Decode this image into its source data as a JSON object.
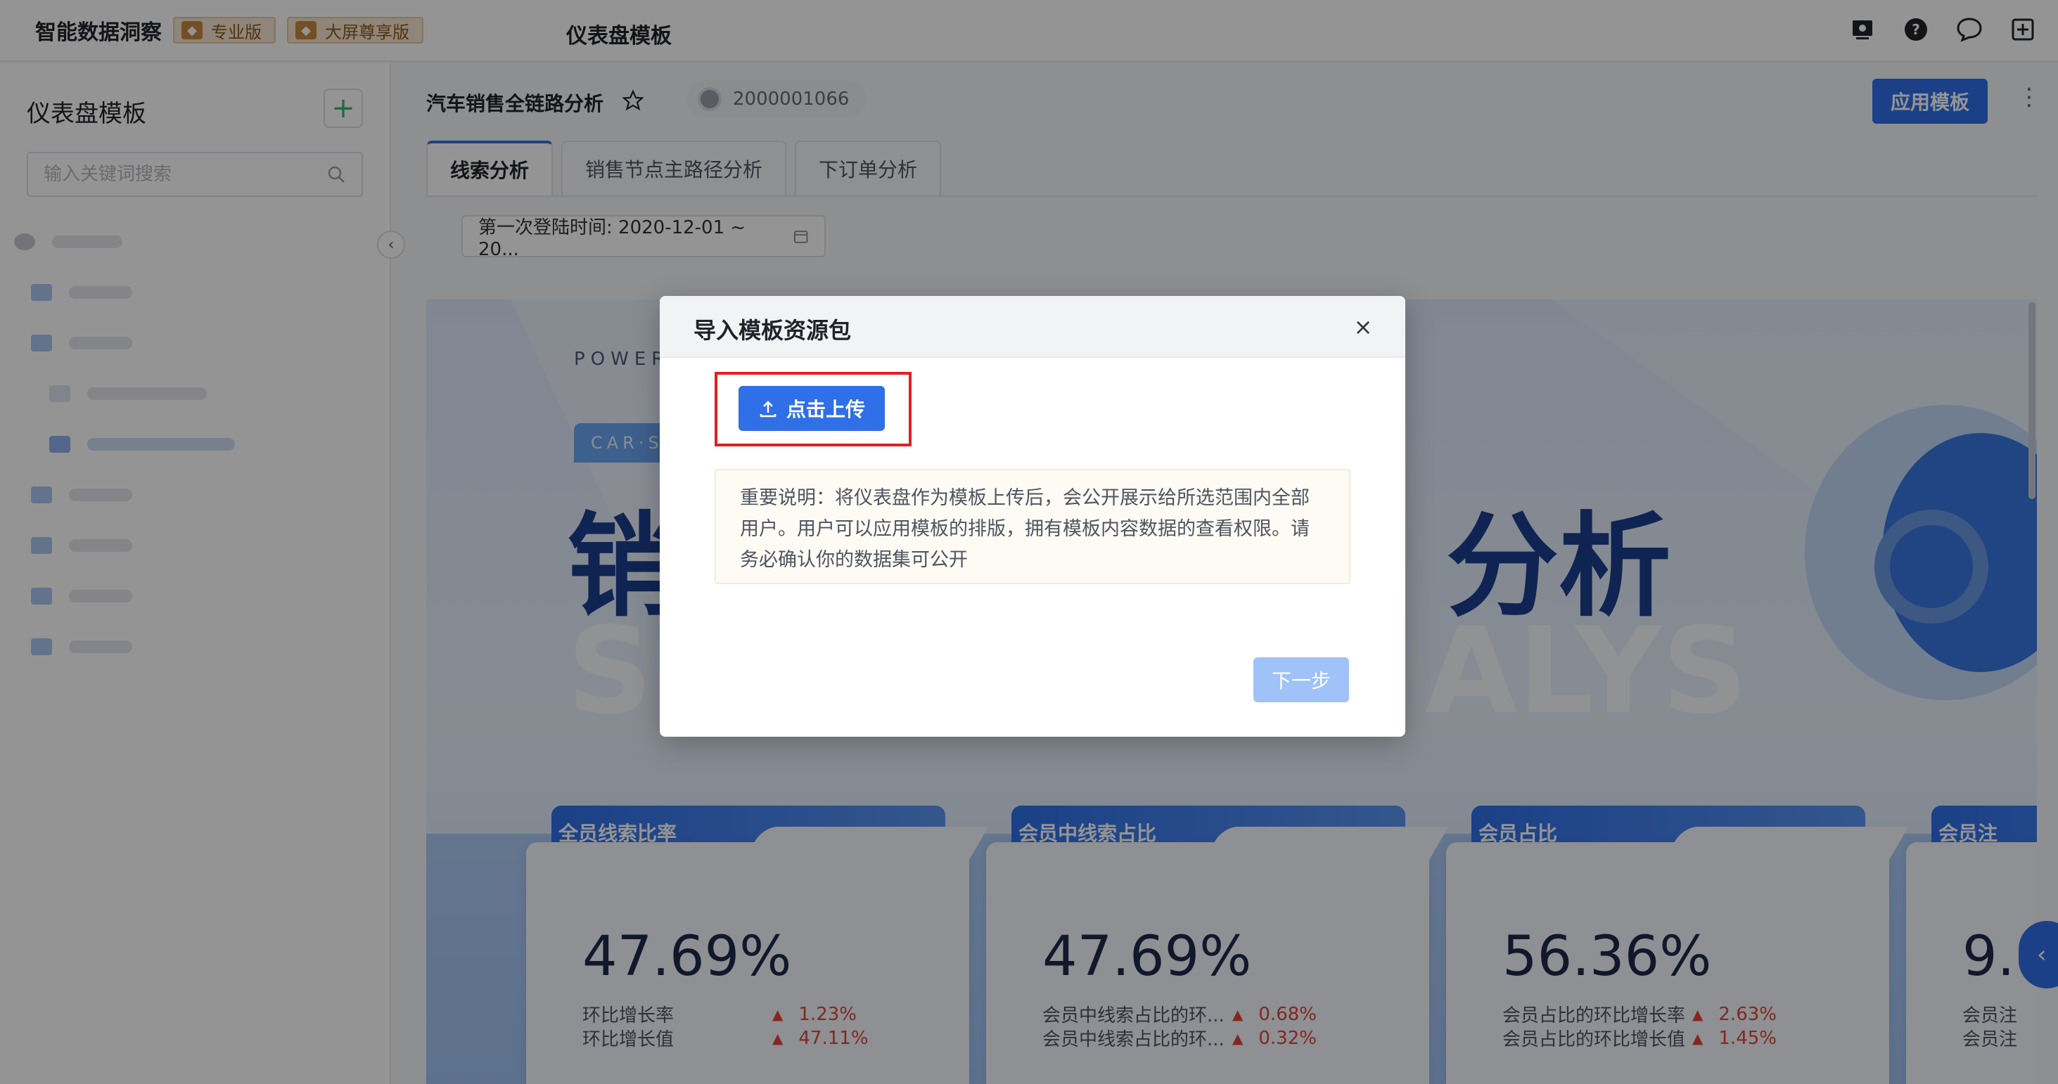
{
  "app": {
    "brand": "智能数据洞察",
    "badges": [
      "专业版",
      "大屏尊享版"
    ],
    "page_title": "仪表盘模板"
  },
  "sidebar": {
    "title": "仪表盘模板",
    "search_placeholder": "输入关键词搜索"
  },
  "main": {
    "doc_title": "汽车销售全链路分析",
    "owner_id": "2000001066",
    "apply_label": "应用模板",
    "tabs": [
      "线索分析",
      "销售节点主路径分析",
      "下订单分析"
    ],
    "filter_text": "第一次登陆时间: 2020-12-01 ~ 20..."
  },
  "canvas": {
    "power_text": "POWER",
    "car_tag": "CAR·S",
    "big_left": "销",
    "big_right": "分析",
    "ghost_left": "S",
    "ghost_right": "ALYS",
    "cards": [
      {
        "title": "全员线索比率",
        "value": "47.69%",
        "rows": [
          {
            "label": "环比增长率",
            "pct": "1.23%"
          },
          {
            "label": "环比增长值",
            "pct": "47.11%"
          }
        ]
      },
      {
        "title": "会员中线索占比",
        "value": "47.69%",
        "rows": [
          {
            "label": "会员中线索占比的环...",
            "pct": "0.68%"
          },
          {
            "label": "会员中线索占比的环...",
            "pct": "0.32%"
          }
        ]
      },
      {
        "title": "会员占比",
        "value": "56.36%",
        "rows": [
          {
            "label": "会员占比的环比增长率",
            "pct": "2.63%"
          },
          {
            "label": "会员占比的环比增长值",
            "pct": "1.45%"
          }
        ]
      },
      {
        "title": "会员注",
        "value": "9.",
        "rows": [
          {
            "label": "会员注",
            "pct": ""
          },
          {
            "label": "会员注",
            "pct": ""
          }
        ]
      }
    ]
  },
  "modal": {
    "title": "导入模板资源包",
    "upload_label": "点击上传",
    "notice": "重要说明：将仪表盘作为模板上传后，会公开展示给所选范围内全部用户。用户可以应用模板的排版，拥有模板内容数据的查看权限。请务必确认你的数据集可公开",
    "next_label": "下一步"
  },
  "colors": {
    "primary": "#2f6fe8",
    "primary_disabled": "#9fc2f8",
    "highlight": "#e02020",
    "increase": "#e0453a"
  }
}
